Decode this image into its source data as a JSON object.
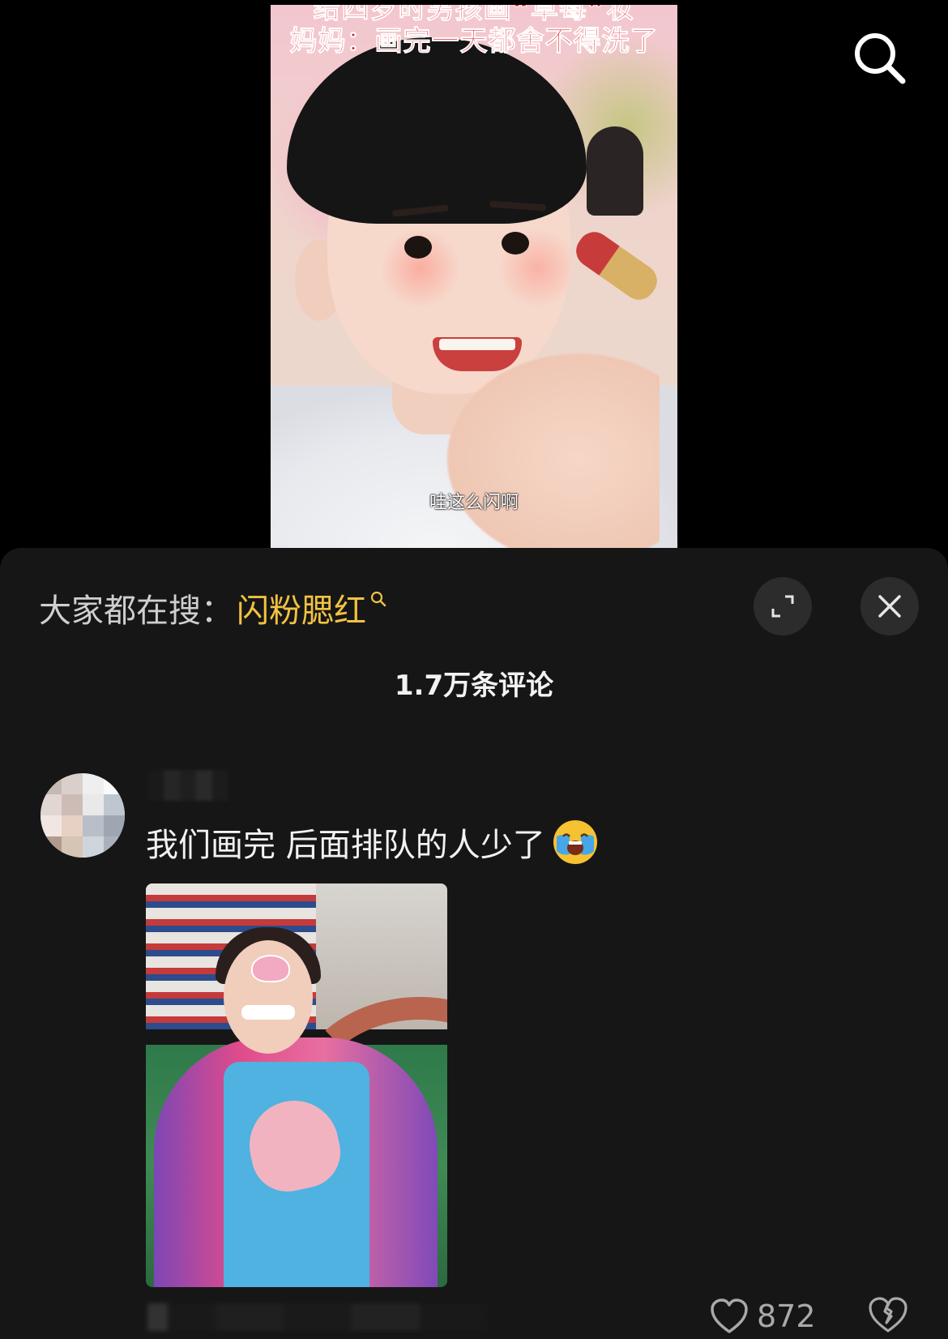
{
  "video": {
    "caption_line1": "给四岁时男孩画“草莓”妆",
    "caption_line2": "妈妈：画完一天都舍不得洗了",
    "subtitle": "哇这么闪啊"
  },
  "top_bar": {
    "search_icon": "search-icon"
  },
  "comments_panel": {
    "search_hint_prefix": "大家都在搜：",
    "search_hint_keyword": "闪粉腮红",
    "expand_icon": "expand-icon",
    "close_icon": "close-icon",
    "comment_count": "1.7万条评论"
  },
  "comment": {
    "text": "我们画完 后面排队的人少了",
    "emoji": "loudly-crying-face",
    "likes": "872",
    "like_icon": "heart-outline-icon",
    "dislike_icon": "broken-heart-icon"
  },
  "colors": {
    "background": "#000000",
    "sheet": "#161616",
    "keyword": "#f1c241",
    "text": "#f2f2f2",
    "muted": "#a9a9a9"
  }
}
